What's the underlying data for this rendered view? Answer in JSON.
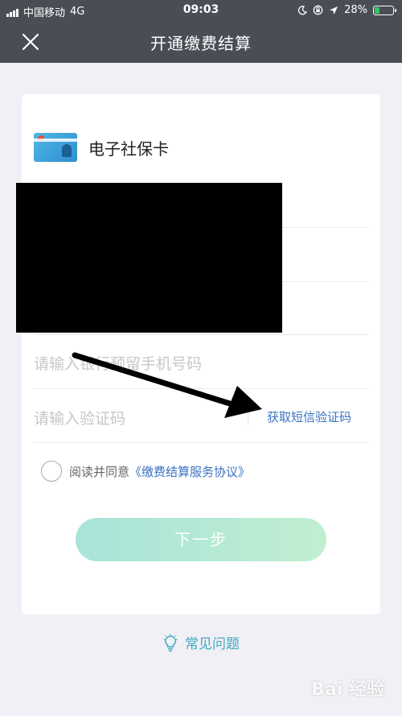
{
  "status_bar": {
    "carrier": "中国移动",
    "network": "4G",
    "time": "09:03",
    "battery_percent": "28%",
    "battery_level": 0.28
  },
  "nav": {
    "title": "开通缴费结算"
  },
  "card": {
    "title": "电子社保卡",
    "phone_placeholder": "请输入银行预留手机号码",
    "code_placeholder": "请输入验证码",
    "sms_button": "获取短信验证码",
    "agree_prefix": "阅读并同意",
    "agree_link": "《缴费结算服务协议》",
    "next_button": "下一步"
  },
  "faq": {
    "label": "常见问题"
  },
  "watermark": "Bai 经验",
  "colors": {
    "header_bg": "#4a4d56",
    "link_blue": "#3a72c2",
    "button_start": "#a9e3da",
    "button_end": "#c0efd0",
    "faq": "#3fa9c0"
  },
  "icons": [
    "close-icon",
    "social-security-card-icon",
    "lightbulb-icon"
  ]
}
